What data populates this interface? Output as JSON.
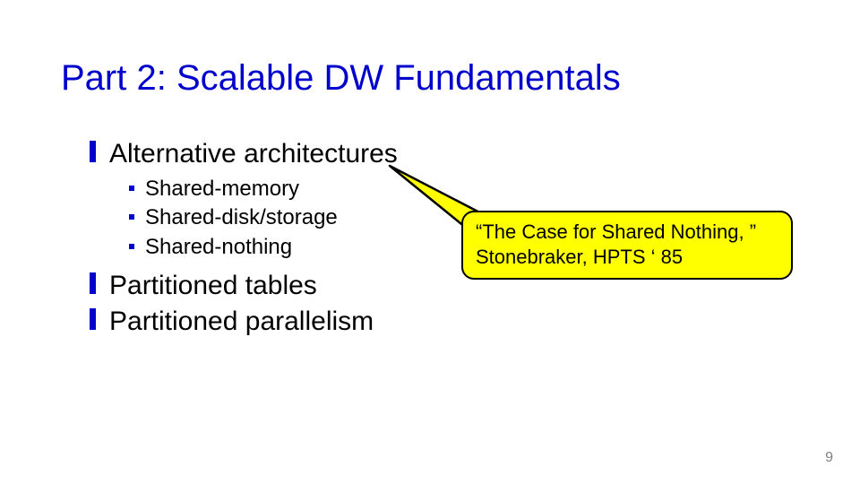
{
  "slide": {
    "title": "Part 2:  Scalable DW Fundamentals",
    "bullets": [
      {
        "label": "Alternative architectures",
        "subs": [
          "Shared-memory",
          "Shared-disk/storage",
          "Shared-nothing"
        ]
      },
      {
        "label": "Partitioned tables"
      },
      {
        "label": "Partitioned parallelism"
      }
    ],
    "callout": {
      "line1": "“The Case for Shared Nothing, ”",
      "line2": "Stonebraker, HPTS ‘ 85"
    },
    "page_number": "9"
  }
}
